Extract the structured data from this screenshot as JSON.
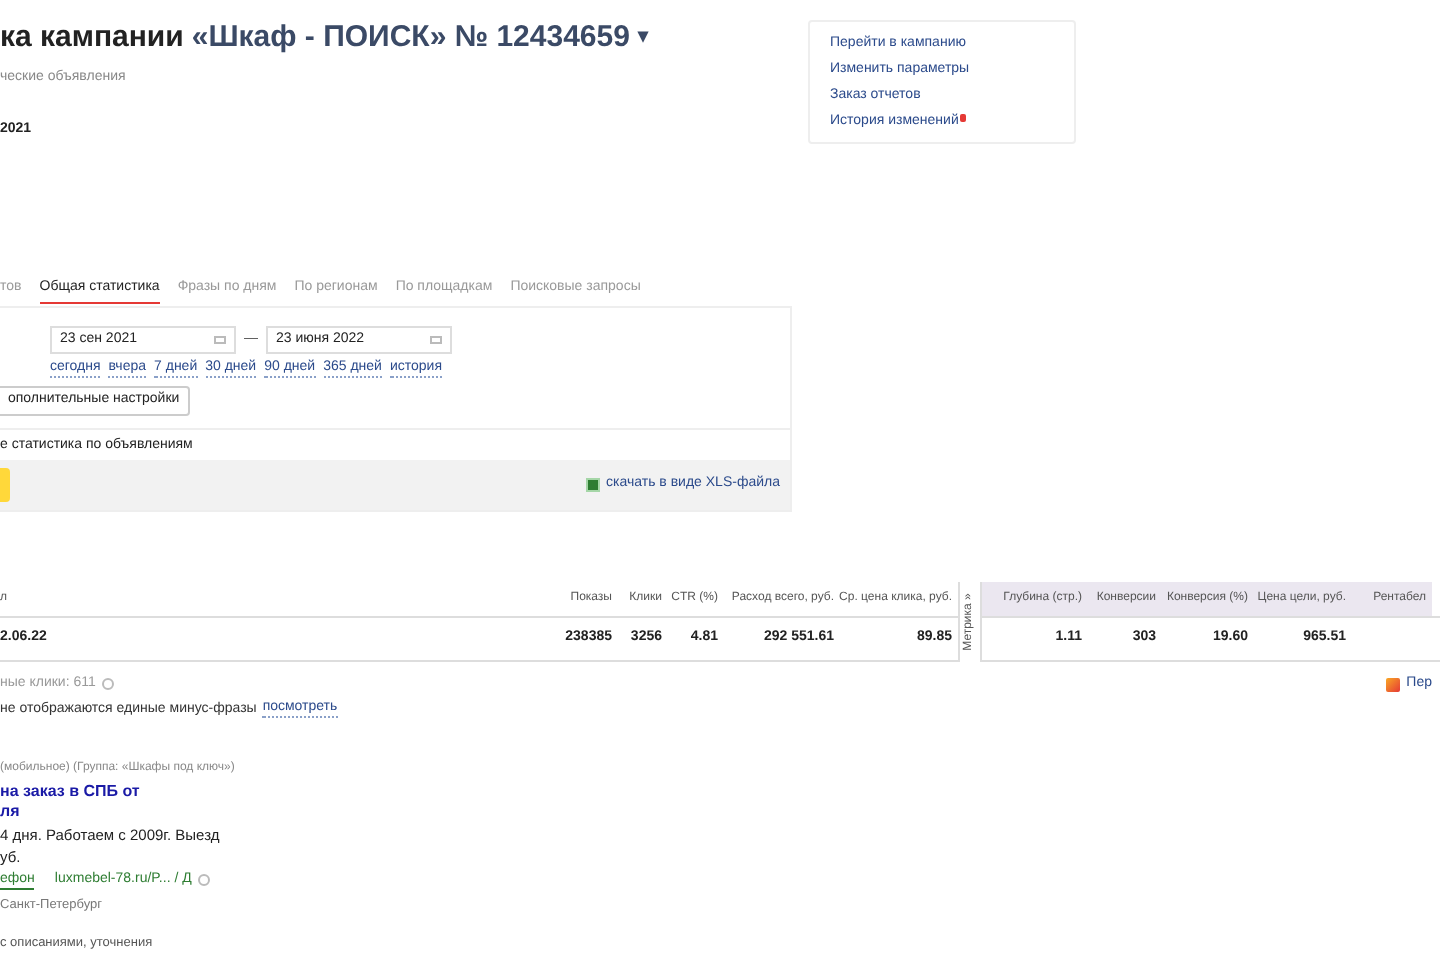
{
  "header": {
    "title_prefix": "ка кампании",
    "title_campaign": "«Шкаф - ПОИСК» № 12434659",
    "title_caret": "▾",
    "subtitle": "ческие объявления",
    "date": "2021"
  },
  "side_links": [
    {
      "label": "Перейти в кампанию",
      "alert": false
    },
    {
      "label": "Изменить параметры",
      "alert": false
    },
    {
      "label": "Заказ отчетов",
      "alert": false
    },
    {
      "label": "История изменений",
      "alert": true
    }
  ],
  "tabs": [
    {
      "label": "тов",
      "selected": false
    },
    {
      "label": "Общая статистика",
      "selected": true
    },
    {
      "label": "Фразы по дням",
      "selected": false
    },
    {
      "label": "По регионам",
      "selected": false
    },
    {
      "label": "По площадкам",
      "selected": false
    },
    {
      "label": "Поисковые запросы",
      "selected": false
    }
  ],
  "period": {
    "from": "23 сен 2021",
    "separator": "—",
    "to": "23 июня 2022",
    "quick_links": [
      "сегодня",
      "вчера",
      "7 дней",
      "30 дней",
      "90 дней",
      "365 дней",
      "история"
    ]
  },
  "settings_button": "ополнительные настройки",
  "ads_option": "е статистика по объявлениям",
  "export_link": "скачать в виде XLS-файла",
  "table": {
    "metrika_label": "Метрика »",
    "columns": [
      {
        "label": "л",
        "kind": "main"
      },
      {
        "label": "Показы",
        "kind": "main"
      },
      {
        "label": "Клики",
        "kind": "main"
      },
      {
        "label": "CTR (%)",
        "kind": "main"
      },
      {
        "label": "Расход всего, руб.",
        "kind": "main"
      },
      {
        "label": "Ср. цена клика, руб.",
        "kind": "main"
      },
      {
        "label": "Глубина (стр.)",
        "kind": "metrika"
      },
      {
        "label": "Конверсии",
        "kind": "metrika"
      },
      {
        "label": "Конверсия (%)",
        "kind": "metrika"
      },
      {
        "label": "Цена цели, руб.",
        "kind": "metrika"
      },
      {
        "label": "Рентабел",
        "kind": "metrika"
      }
    ],
    "rows": [
      [
        "2.06.22",
        "238385",
        "3256",
        "4.81",
        "292 551.61",
        "89.85",
        "1.11",
        "303",
        "19.60",
        "965.51",
        ""
      ]
    ]
  },
  "clicks_note": "ные клики: 611",
  "right_link": "Пер",
  "minus_note": {
    "text": "не отображаются единые минус-фразы",
    "link": "посмотреть"
  },
  "ad": {
    "meta": "(мобильное) (Группа: «Шкафы под ключ»)",
    "title_lines": [
      "на заказ в СПБ от",
      "ля"
    ],
    "text_lines": [
      "4 дня. Работаем с 2009г. Выезд",
      "уб."
    ],
    "phone": "ефон",
    "url": "luxmebel-78.ru/P... / Д",
    "region": "Санкт-Петербург"
  },
  "bottom_note": "с описаниями, уточнения"
}
